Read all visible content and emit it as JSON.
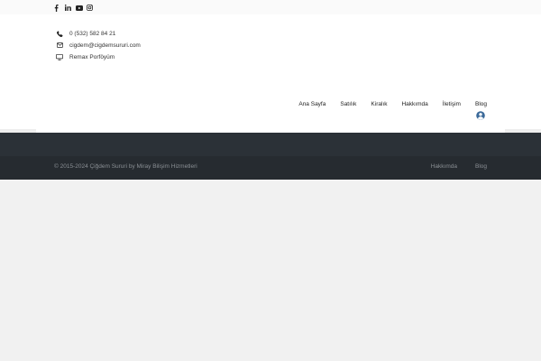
{
  "social": {
    "icons": [
      "facebook-icon",
      "linkedin-icon",
      "youtube-icon",
      "instagram-icon"
    ],
    "color": "#222222"
  },
  "contact": {
    "phone": "0 (532) 582 84 21",
    "email": "cigdem@cigdemsururi.com",
    "portfolio": "Remax Porföyüm"
  },
  "nav": {
    "items": [
      "Ana Sayfa",
      "Satılık",
      "Kiralık",
      "Hakkımda",
      "İletişim",
      "Blog"
    ]
  },
  "user_icon": {
    "name": "user-circle-icon",
    "color": "#3b6a9a"
  },
  "footer": {
    "copyright": "© 2015-2024 Çiğdem Sururi by Miray Bilişim Hizmetleri",
    "links": [
      "Hakkımda",
      "Blog"
    ],
    "bar_color": "#262b30",
    "band_color": "#2b3137"
  }
}
